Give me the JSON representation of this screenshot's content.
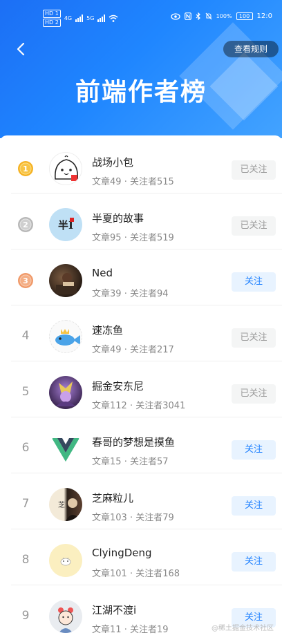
{
  "status_bar": {
    "hd1": "HD 1",
    "hd2": "HD 2",
    "net4g": "4G",
    "net5g": "5G",
    "battery": "100",
    "battery_pct": "100%",
    "time": "12:0"
  },
  "header": {
    "title": "前端作者榜",
    "rules_label": "查看规则",
    "back_icon": "chevron-left-icon"
  },
  "colors": {
    "header_blue": "#1f86ff",
    "follow_blue": "#1e80ff",
    "gold": "#f5b325",
    "silver": "#b8b8b8",
    "bronze": "#f09a6a"
  },
  "authors": [
    {
      "rank": "1",
      "name": "战场小包",
      "articles": "文章49",
      "sep": "·",
      "followers": "关注者515",
      "button": "已关注"
    },
    {
      "rank": "2",
      "name": "半夏的故事",
      "articles": "文章95",
      "sep": "·",
      "followers": "关注者519",
      "button": "已关注"
    },
    {
      "rank": "3",
      "name": "Ned",
      "articles": "文章39",
      "sep": "·",
      "followers": "关注者94",
      "button": "关注"
    },
    {
      "rank": "4",
      "name": "速冻鱼",
      "articles": "文章49",
      "sep": "·",
      "followers": "关注者217",
      "button": "已关注"
    },
    {
      "rank": "5",
      "name": "掘金安东尼",
      "articles": "文章112",
      "sep": "·",
      "followers": "关注者3041",
      "button": "已关注"
    },
    {
      "rank": "6",
      "name": "春哥的梦想是摸鱼",
      "articles": "文章15",
      "sep": "·",
      "followers": "关注者57",
      "button": "关注"
    },
    {
      "rank": "7",
      "name": "芝麻粒儿",
      "articles": "文章103",
      "sep": "·",
      "followers": "关注者79",
      "button": "关注"
    },
    {
      "rank": "8",
      "name": "ClyingDeng",
      "articles": "文章101",
      "sep": "·",
      "followers": "关注者168",
      "button": "关注"
    },
    {
      "rank": "9",
      "name": "江湖不渡i",
      "articles": "文章11",
      "sep": "·",
      "followers": "关注者19",
      "button": "关注"
    }
  ],
  "watermark": "@稀土掘金技术社区"
}
